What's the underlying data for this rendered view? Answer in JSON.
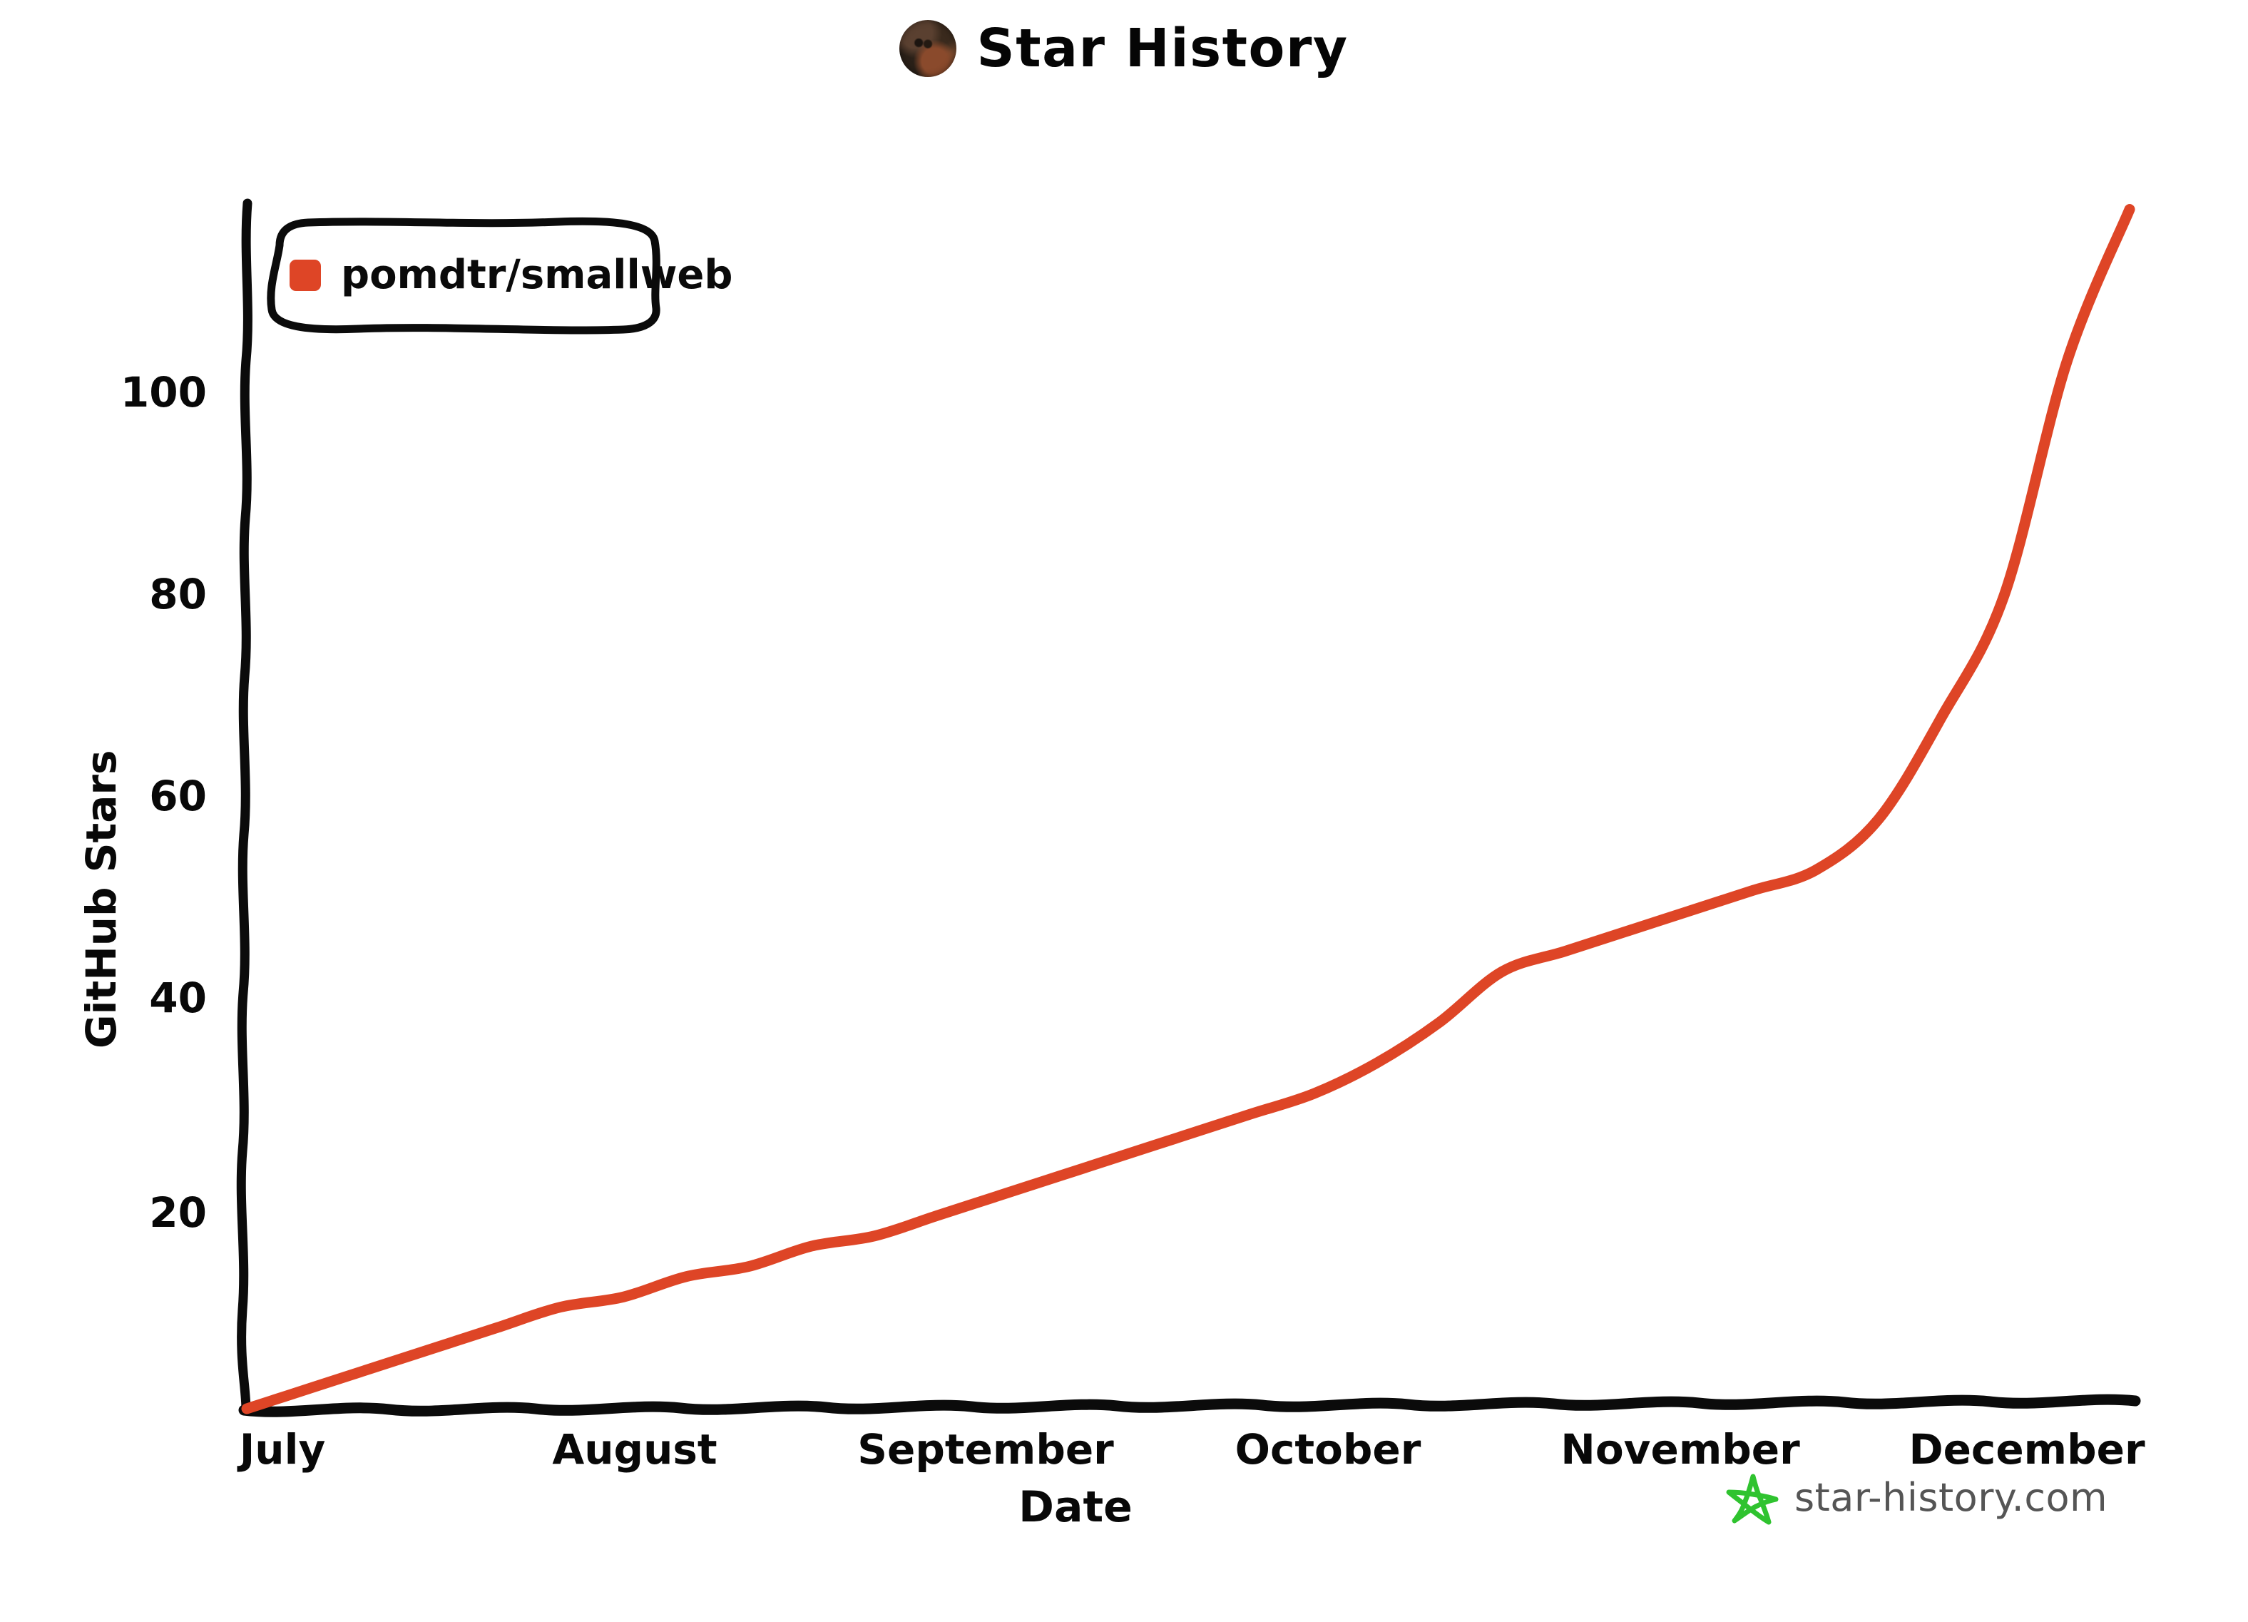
{
  "header": {
    "title": "Star History",
    "avatar_name": "repo-owner-avatar"
  },
  "legend": {
    "entries": [
      {
        "label": "pomdtr/smallweb",
        "color": "#DE4526",
        "marker": "square"
      }
    ]
  },
  "watermark": {
    "text": "star-history.com",
    "icon": "star-icon",
    "icon_color": "#2FC32F",
    "text_color": "#555555"
  },
  "chart_data": {
    "type": "line",
    "title": "Star History",
    "xlabel": "Date",
    "ylabel": "GitHub Stars",
    "grid": false,
    "legend_position": "top-left",
    "line_color": "#DE4526",
    "x_tick_labels": [
      "July",
      "August",
      "September",
      "October",
      "November",
      "December"
    ],
    "y_tick_labels": [
      "20",
      "40",
      "60",
      "80",
      "100"
    ],
    "y_ticks": [
      20,
      40,
      60,
      80,
      100
    ],
    "ylim": [
      0,
      119
    ],
    "xlim": [
      "2024-07-01",
      "2024-12-26"
    ],
    "series": [
      {
        "name": "pomdtr/smallweb",
        "color": "#DE4526",
        "x": [
          "2024-07-01",
          "2024-07-08",
          "2024-07-15",
          "2024-07-22",
          "2024-07-29",
          "2024-08-05",
          "2024-08-12",
          "2024-08-19",
          "2024-08-26",
          "2024-09-02",
          "2024-09-09",
          "2024-09-16",
          "2024-09-23",
          "2024-09-30",
          "2024-10-07",
          "2024-10-14",
          "2024-10-21",
          "2024-10-28",
          "2024-11-04",
          "2024-11-11",
          "2024-11-18",
          "2024-11-25",
          "2024-12-02",
          "2024-12-09",
          "2024-12-13",
          "2024-12-16",
          "2024-12-18",
          "2024-12-20",
          "2024-12-22",
          "2024-12-24",
          "2024-12-26"
        ],
        "values": [
          0,
          2,
          4,
          6,
          8,
          10,
          11,
          13,
          14,
          16,
          17,
          19,
          21,
          23,
          25,
          27,
          29,
          31,
          34,
          38,
          43,
          45,
          47,
          49,
          51,
          53,
          58,
          68,
          80,
          103,
          118
        ]
      }
    ]
  }
}
